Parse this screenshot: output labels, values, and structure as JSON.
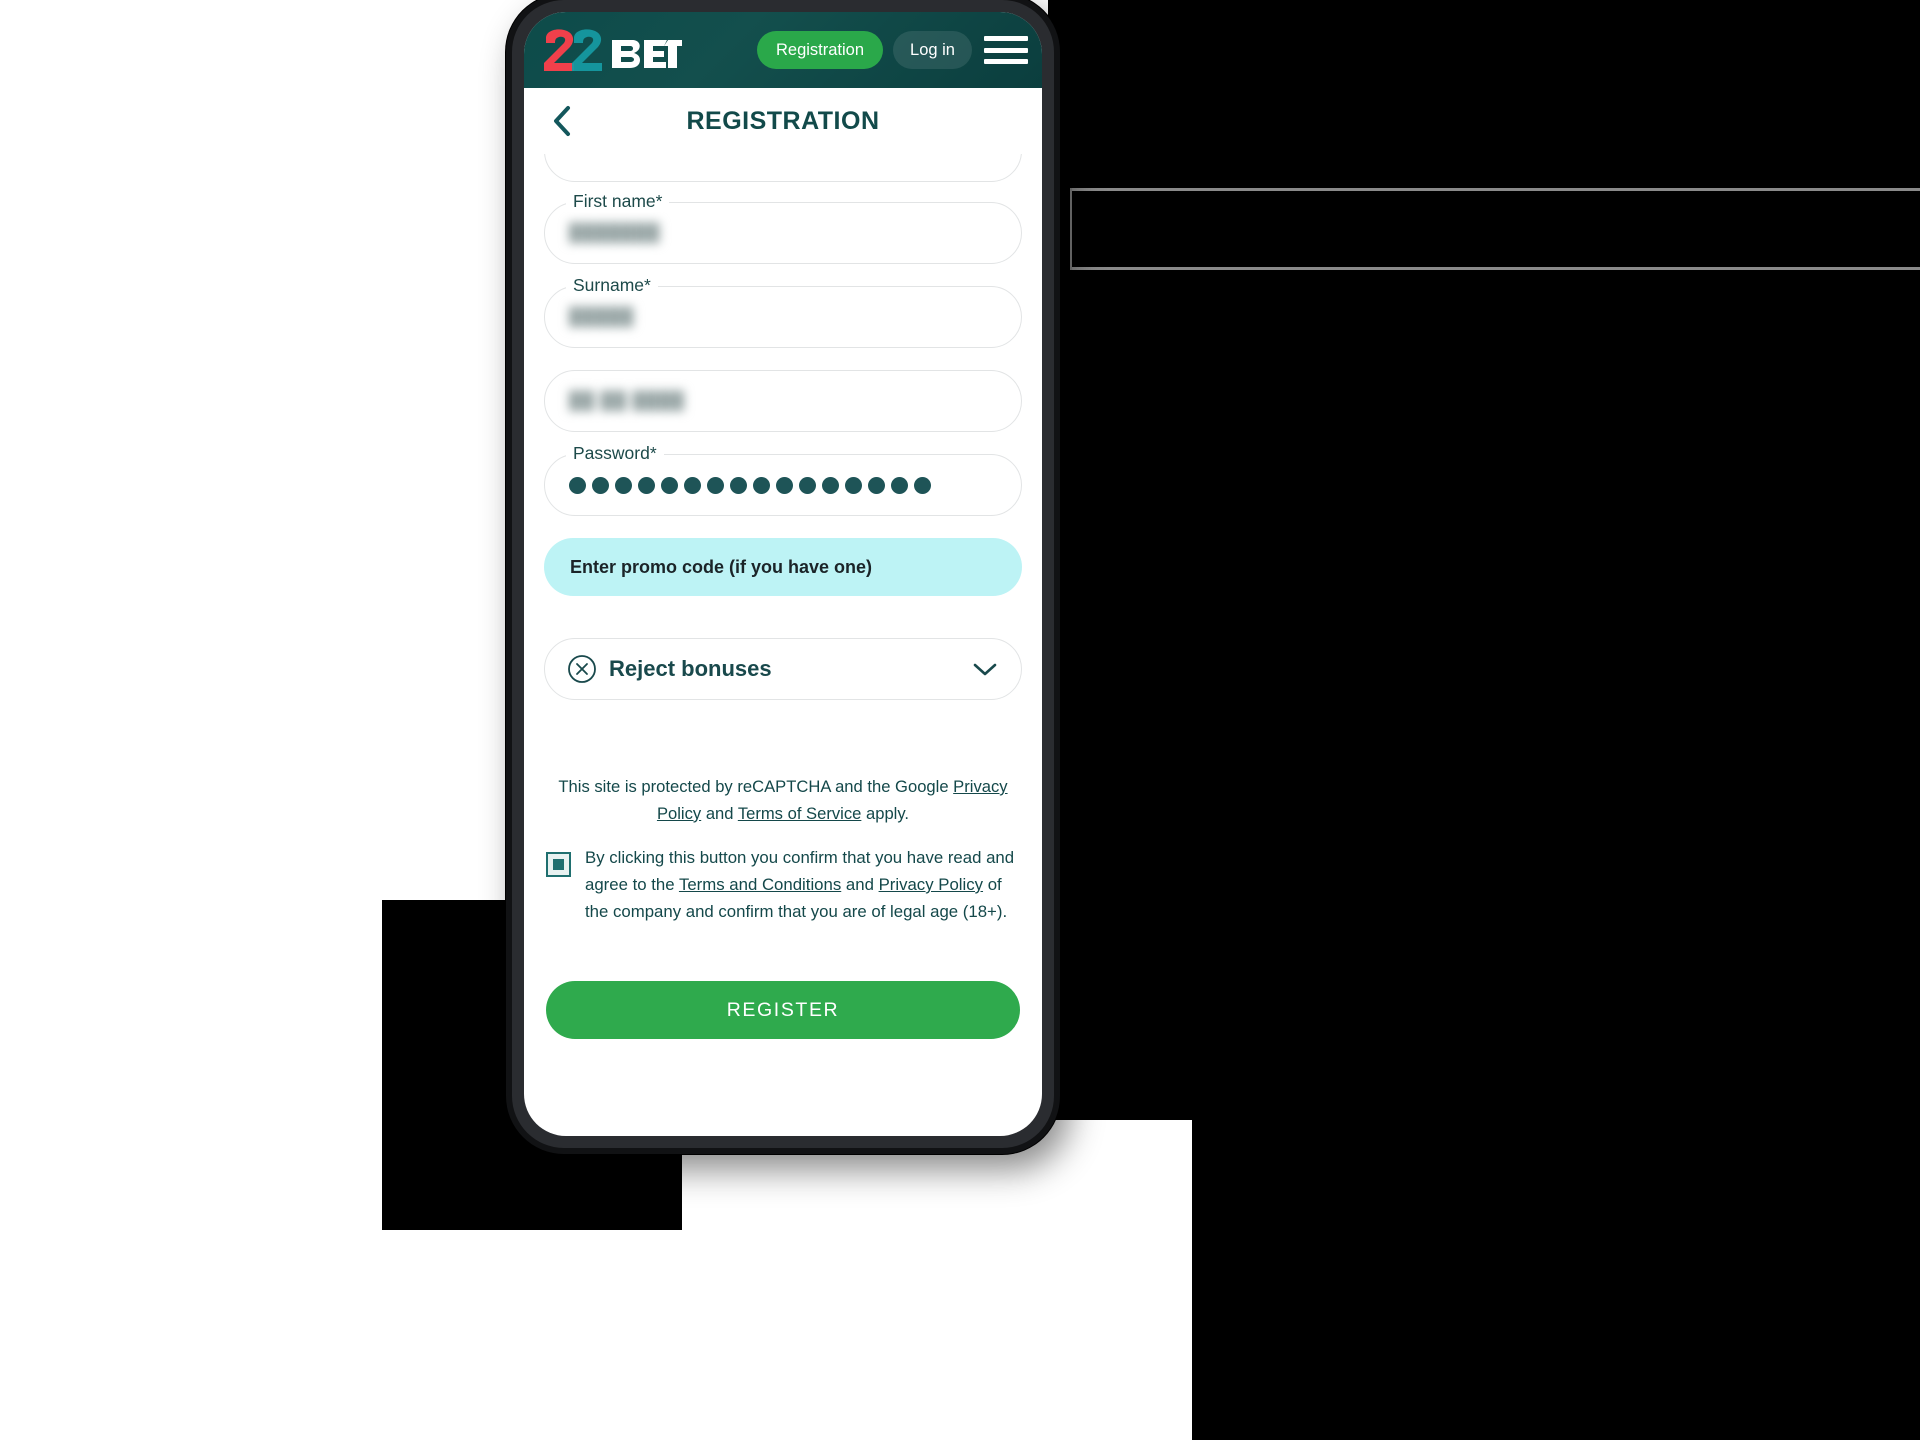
{
  "brand": {
    "logo_text_primary": "22",
    "logo_text_secondary": "BET",
    "color_red": "#f0404b",
    "color_teal": "#159ba4",
    "header_bg": "#0d4b4a",
    "accent_green": "#2aa84a",
    "promo_bg": "#bdf3f5",
    "text_teal": "#14484a"
  },
  "header": {
    "registration_button": "Registration",
    "login_button": "Log in",
    "menu_icon": "hamburger-menu-icon"
  },
  "page": {
    "back_icon": "chevron-left-icon",
    "title": "REGISTRATION"
  },
  "form": {
    "fields": [
      {
        "label": "",
        "value": "",
        "type": "cropped",
        "redacted": true
      },
      {
        "label": "First name",
        "required": "*",
        "value": "███████",
        "type": "text",
        "redacted": true
      },
      {
        "label": "Surname",
        "required": "*",
        "value": "█████",
        "type": "text",
        "redacted": true
      },
      {
        "label": "",
        "required": "",
        "value": "██ ██ ████",
        "type": "date",
        "redacted": true
      },
      {
        "label": "Password",
        "required": "*",
        "value": "",
        "type": "password",
        "dots": 16,
        "redacted": false
      }
    ],
    "promo": {
      "label": "Enter promo code (if you have one)"
    },
    "bonus": {
      "icon": "circle-x-icon",
      "label": "Reject bonuses",
      "chevron": "chevron-down-icon"
    }
  },
  "legal": {
    "recaptcha_prefix": "This site is protected by reCAPTCHA and the Google ",
    "recaptcha_privacy": "Privacy Policy",
    "recaptcha_and": " and ",
    "recaptcha_terms": "Terms of Service",
    "recaptcha_suffix": " apply.",
    "checkbox_state": "checked",
    "terms_part1": "By clicking this button you confirm that you have read and agree to the ",
    "terms_link1": "Terms and Conditions",
    "terms_mid": " and ",
    "terms_link2": "Privacy Policy",
    "terms_part2": " of the company and confirm that you are of legal age (18+)."
  },
  "actions": {
    "register_button": "REGISTER"
  }
}
